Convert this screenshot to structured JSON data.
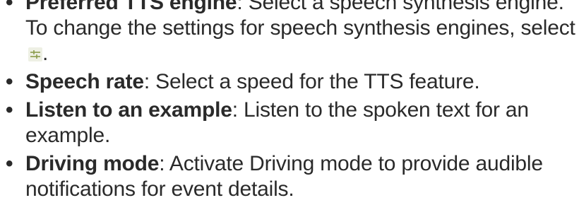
{
  "items": [
    {
      "term": "Preferred TTS engine",
      "sep": ":",
      "desc": " Select a speech synthesis engine. To change the settings for speech synthesis engines, select ",
      "icon": "settings-sliders-icon",
      "tail": "."
    },
    {
      "term": "Speech rate",
      "sep": ":",
      "desc": " Select a speed for the TTS feature."
    },
    {
      "term": "Listen to an example",
      "sep": ":",
      "desc": " Listen to the spoken text for an example."
    },
    {
      "term": "Driving mode",
      "sep": ":",
      "desc": " Activate Driving mode to provide audible notifications for event details."
    }
  ],
  "bullet": "•",
  "colors": {
    "text": "#2a2a2a",
    "icon": "#8a9a4a"
  }
}
